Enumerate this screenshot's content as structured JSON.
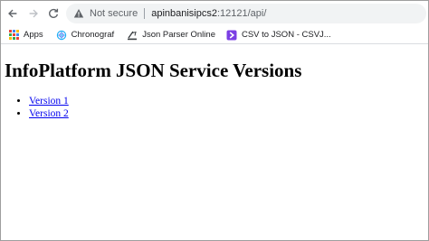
{
  "browser": {
    "security_text": "Not secure",
    "url_host": "apinbanisipcs2",
    "url_rest": ":12121/api/"
  },
  "bookmarks": [
    {
      "label": "Apps",
      "icon": "apps-grid-icon"
    },
    {
      "label": "Chronograf",
      "icon": "chronograf-icon"
    },
    {
      "label": "Json Parser Online",
      "icon": "json-parser-icon"
    },
    {
      "label": "CSV to JSON - CSVJ...",
      "icon": "csv-to-json-icon"
    }
  ],
  "page": {
    "heading": "InfoPlatform JSON Service Versions",
    "links": [
      {
        "label": "Version 1"
      },
      {
        "label": "Version 2"
      }
    ]
  },
  "colors": {
    "link": "#0000ee",
    "omnibox_bg": "#f1f3f4",
    "csv_icon": "#7b3fe4"
  }
}
